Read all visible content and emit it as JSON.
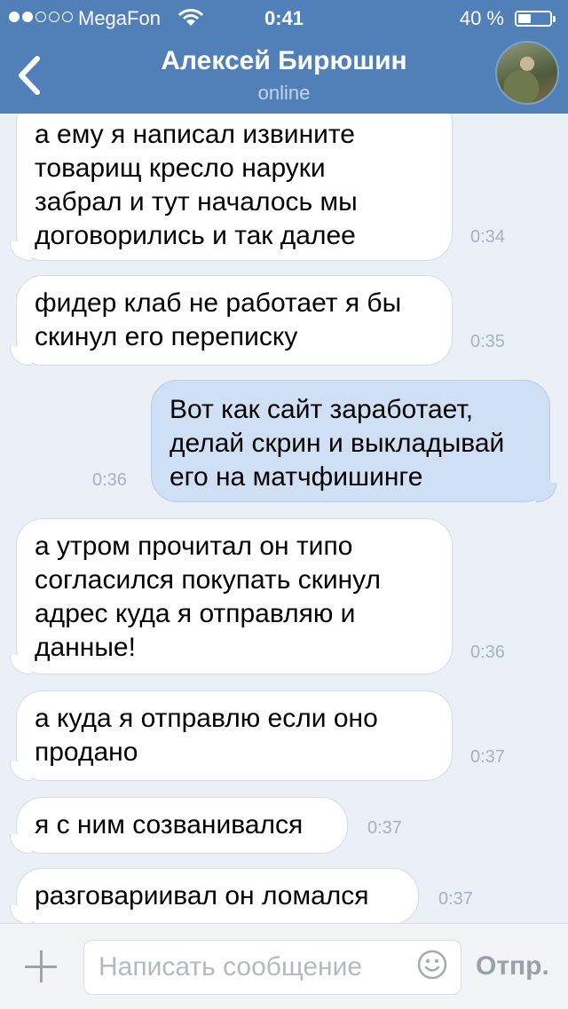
{
  "status_bar": {
    "carrier": "MegaFon",
    "time": "0:41",
    "battery": "40 %",
    "battery_level": 0.4,
    "signal_bars": 2
  },
  "nav": {
    "title": "Алексей Бирюшин",
    "subtitle": "online"
  },
  "messages": [
    {
      "direction": "in",
      "lines": [
        "а ему я написал извините",
        "товарищ кресло наруки",
        "забрал и тут началось мы",
        "договорились и так далее"
      ],
      "time": "0:34"
    },
    {
      "direction": "in",
      "lines": [
        "фидер клаб не работает я бы",
        "скинул его переписку"
      ],
      "time": "0:35"
    },
    {
      "direction": "out",
      "lines": [
        "Вот как сайт заработает,",
        "делай скрин и выкладывай",
        "его на матчфишинге"
      ],
      "time": "0:36"
    },
    {
      "direction": "in",
      "lines": [
        "а утром прочитал он типо",
        "согласился покупать скинул",
        "адрес куда я отправляю и",
        "данные!"
      ],
      "time": "0:36"
    },
    {
      "direction": "in",
      "lines": [
        "а куда я отправлю если оно",
        "продано"
      ],
      "time": "0:37"
    },
    {
      "direction": "in",
      "lines": [
        "я с ним созванивался"
      ],
      "time": "0:37"
    },
    {
      "direction": "in",
      "lines": [
        "разговариивал он ломался"
      ],
      "time": "0:37"
    }
  ],
  "composer": {
    "placeholder": "Написать сообщение",
    "send_label": "Отпр."
  },
  "colors": {
    "header": "#5180b8",
    "background": "#eaf0f6",
    "incoming_bubble": "#ffffff",
    "outgoing_bubble": "#cfe0f5"
  }
}
